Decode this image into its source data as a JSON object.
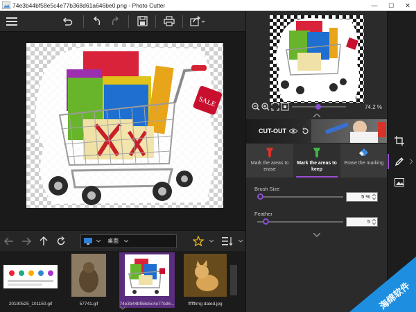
{
  "window": {
    "title": "74e3b44bf58e5c4e77b368d61a646be0.png - Photo Cutter",
    "controls": {
      "minimize": "—",
      "maximize": "☐",
      "close": "✕"
    }
  },
  "toolbar": {
    "icons": [
      "menu-icon",
      "undo-icon",
      "undo-step-icon",
      "redo-icon",
      "save-icon",
      "print-icon",
      "share-icon"
    ]
  },
  "preview": {
    "zoom_value": "74.2 %"
  },
  "cutout": {
    "label": "CUT-OUT"
  },
  "modes": [
    {
      "label_line1": "Mark the areas to",
      "label_line2": "erase",
      "icon": "marker-red-icon",
      "active": false
    },
    {
      "label_line1": "Mark the areas to",
      "label_line2": "keep",
      "icon": "marker-green-icon",
      "active": true
    },
    {
      "label_line1": "Erase the marking",
      "label_line2": "",
      "icon": "eraser-icon",
      "active": false
    }
  ],
  "brush_size": {
    "label": "Brush Size",
    "value": "5 %",
    "level": 0.05
  },
  "feather": {
    "label": "Feather",
    "value": "5",
    "level": 0.1
  },
  "navigation": {
    "path_label": "桌面"
  },
  "filmstrip": {
    "items": [
      {
        "caption": "20190525_101150.gif",
        "selected": false
      },
      {
        "caption": "57741.gif",
        "selected": false
      },
      {
        "caption": "74e3b44bf58e5c4e77b36...",
        "selected": true
      },
      {
        "caption": "ffffffimg dated.jpg",
        "selected": false
      }
    ]
  },
  "watermark": {
    "text": "海绵软件"
  },
  "colors": {
    "accent": "#9b4fd8",
    "selection": "#5b2d7e",
    "background": "#202020"
  }
}
